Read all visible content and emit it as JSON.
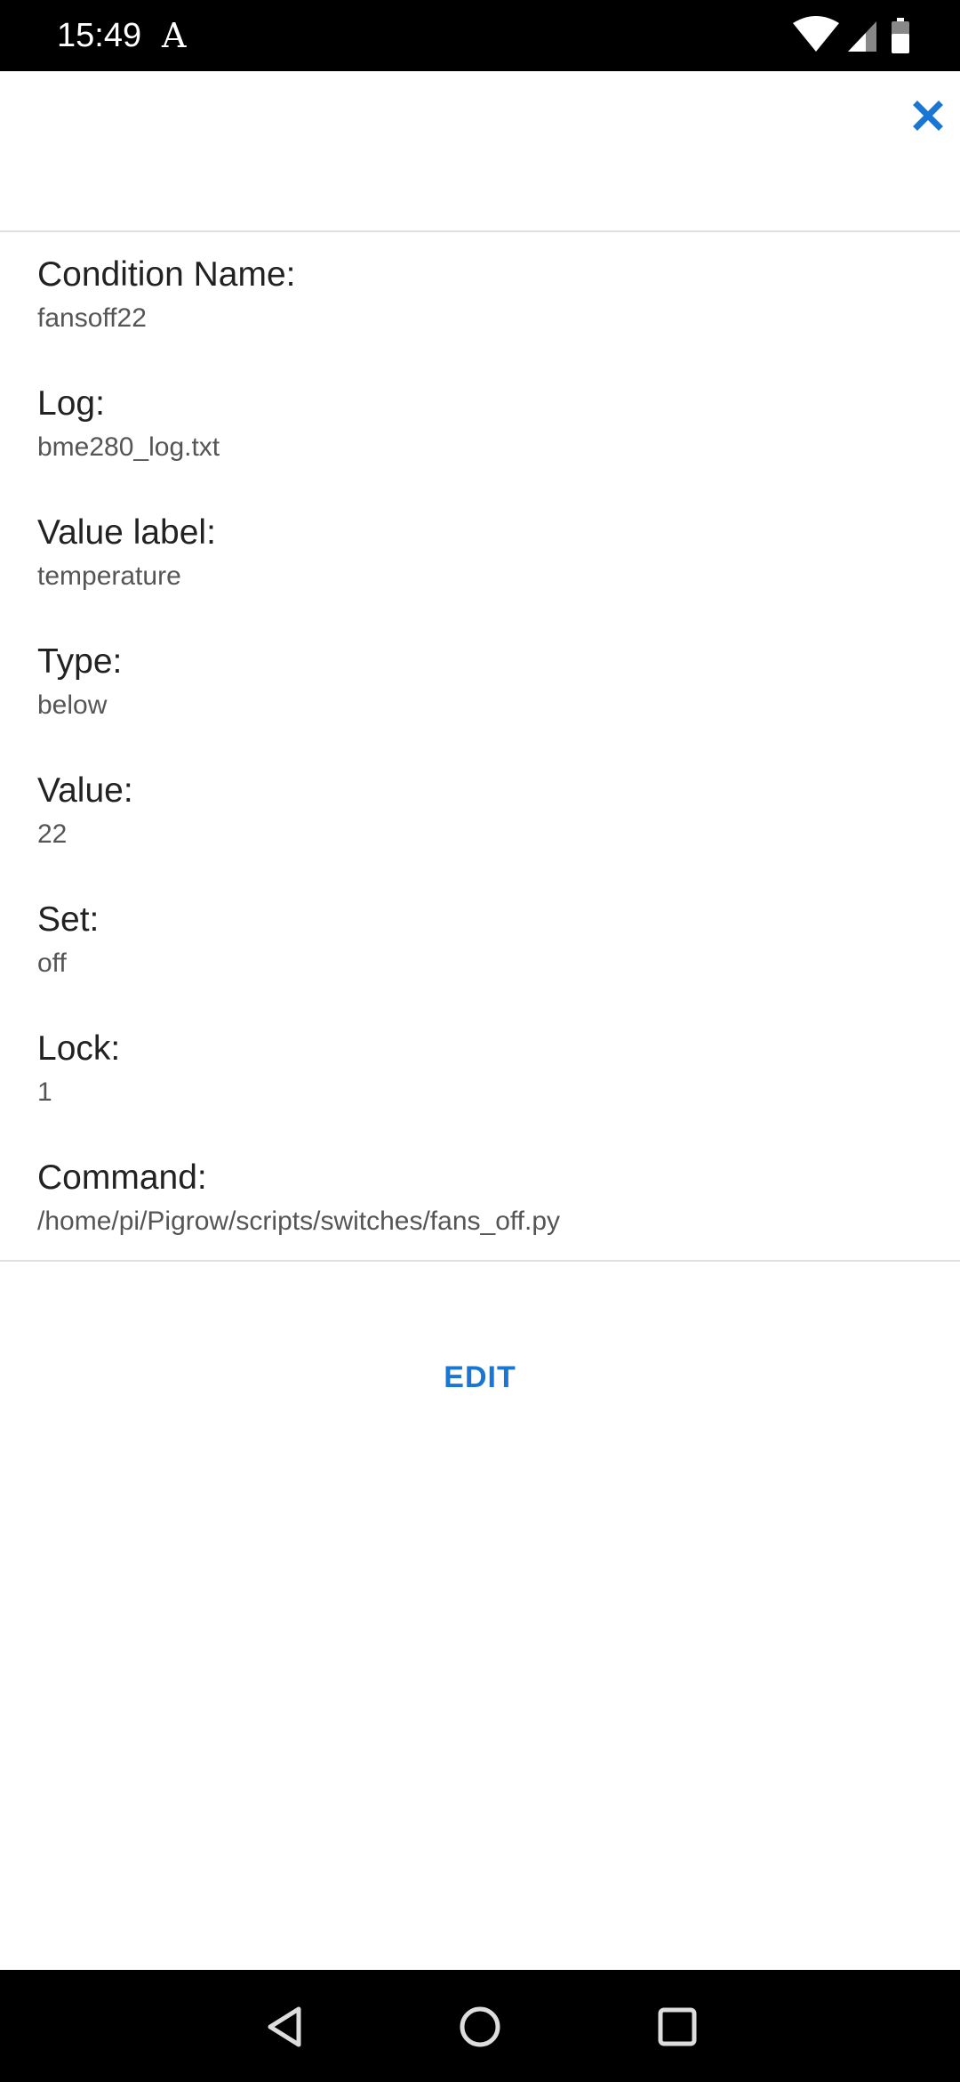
{
  "status_bar": {
    "time": "15:49",
    "indicator": "A"
  },
  "fields": [
    {
      "label": "Condition Name:",
      "value": "fansoff22"
    },
    {
      "label": "Log:",
      "value": "bme280_log.txt"
    },
    {
      "label": "Value label:",
      "value": "temperature"
    },
    {
      "label": "Type:",
      "value": "below"
    },
    {
      "label": "Value:",
      "value": "22"
    },
    {
      "label": "Set:",
      "value": "off"
    },
    {
      "label": "Lock:",
      "value": "1"
    },
    {
      "label": "Command:",
      "value": "/home/pi/Pigrow/scripts/switches/fans_off.py"
    }
  ],
  "actions": {
    "edit_label": "EDIT"
  },
  "colors": {
    "accent": "#1976d2",
    "status_bar_bg": "#000000",
    "nav_bar_bg": "#000000"
  },
  "icons": {
    "close": "close-icon",
    "wifi": "wifi-icon",
    "signal": "cell-signal-icon",
    "battery": "battery-icon",
    "back": "back-icon",
    "home": "home-icon",
    "recents": "recents-icon"
  }
}
